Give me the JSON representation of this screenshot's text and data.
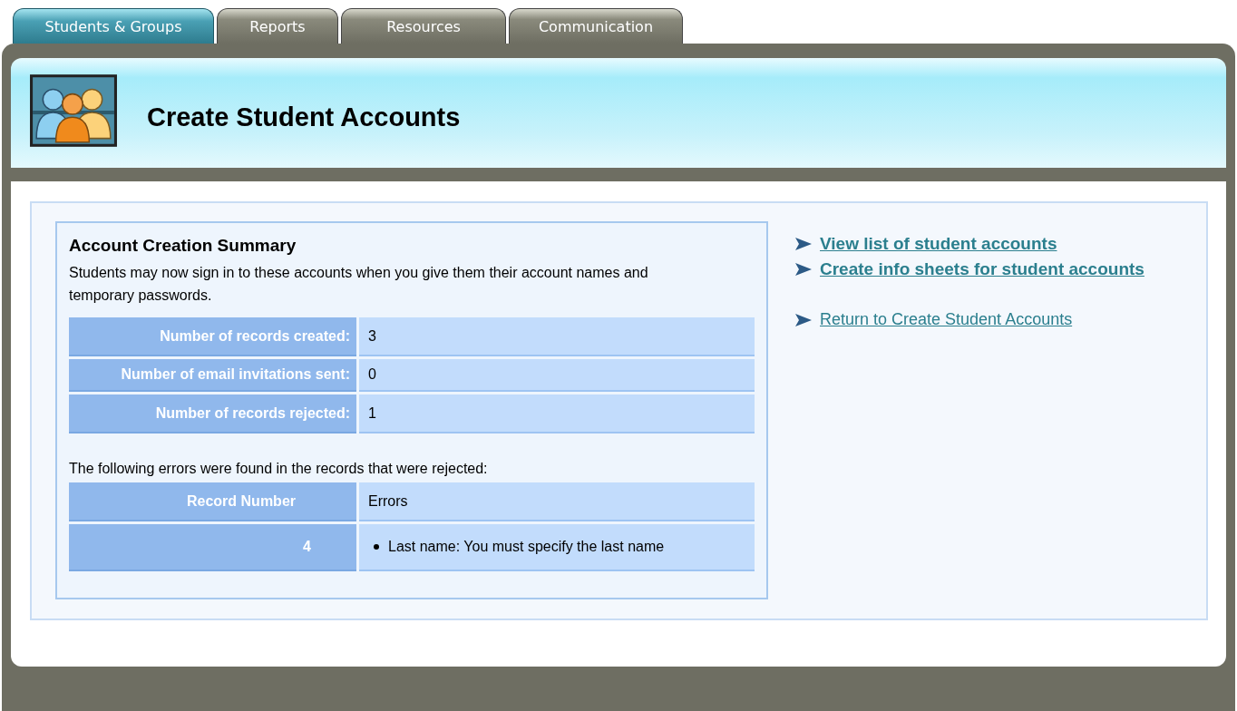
{
  "tabs": [
    {
      "label": "Students & Groups",
      "selected": true
    },
    {
      "label": "Reports",
      "selected": false
    },
    {
      "label": "Resources",
      "selected": false
    },
    {
      "label": "Communication",
      "selected": false
    }
  ],
  "header": {
    "title": "Create Student Accounts"
  },
  "summary": {
    "title": "Account Creation Summary",
    "intro": "Students may now sign in to these accounts when you give them their account names and temporary passwords.",
    "stats": [
      {
        "label": "Number of records created:",
        "value": "3"
      },
      {
        "label": "Number of email invitations sent:",
        "value": "0"
      },
      {
        "label": "Number of records rejected:",
        "value": "1"
      }
    ],
    "errors_intro": "The following errors were found in the records that were rejected:",
    "errors_table": {
      "columns": [
        "Record Number",
        "Errors"
      ],
      "rows": [
        {
          "record": "4",
          "errors": [
            "Last name: You must specify the  last name"
          ]
        }
      ]
    }
  },
  "links": [
    {
      "label": "View list of student accounts",
      "kind": "primary"
    },
    {
      "label": "Create info sheets for student accounts",
      "kind": "primary"
    },
    {
      "label": "Return to Create Student Accounts",
      "kind": "secondary"
    }
  ]
}
